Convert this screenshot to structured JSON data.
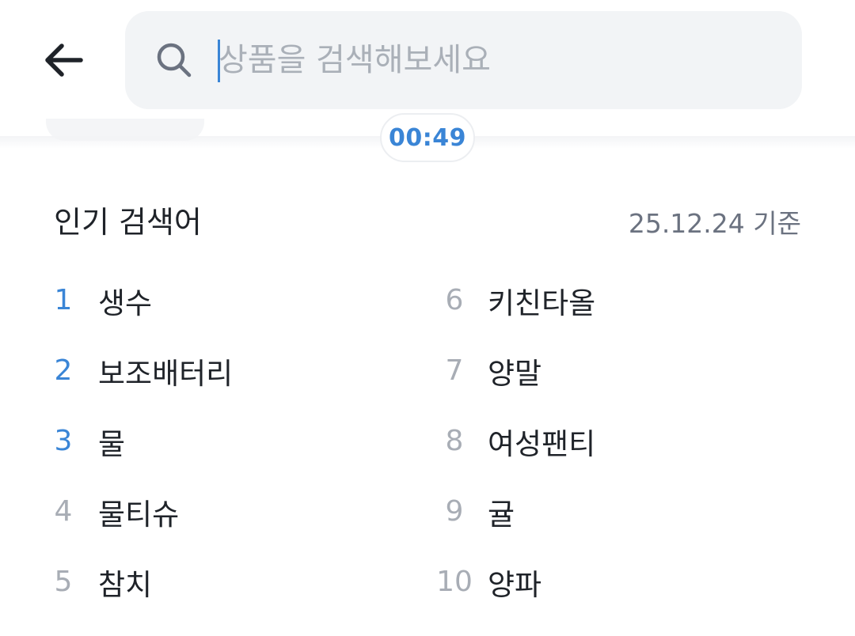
{
  "header": {
    "back_icon": "arrow-left-icon",
    "search": {
      "icon": "search-icon",
      "placeholder": "상품을 검색해보세요",
      "value": ""
    }
  },
  "timer": {
    "value": "00:49"
  },
  "popular": {
    "title": "인기 검색어",
    "date": "25.12.24 기준",
    "items": [
      {
        "rank": "1",
        "keyword": "생수"
      },
      {
        "rank": "2",
        "keyword": "보조배터리"
      },
      {
        "rank": "3",
        "keyword": "물"
      },
      {
        "rank": "4",
        "keyword": "물티슈"
      },
      {
        "rank": "5",
        "keyword": "참치"
      },
      {
        "rank": "6",
        "keyword": "키친타올"
      },
      {
        "rank": "7",
        "keyword": "양말"
      },
      {
        "rank": "8",
        "keyword": "여성팬티"
      },
      {
        "rank": "9",
        "keyword": "귤"
      },
      {
        "rank": "10",
        "keyword": "양파"
      }
    ]
  },
  "colors": {
    "accent": "#3a85d6",
    "muted_rank": "#a8adb5",
    "search_bg": "#f2f4f6",
    "text": "#1f2329"
  }
}
